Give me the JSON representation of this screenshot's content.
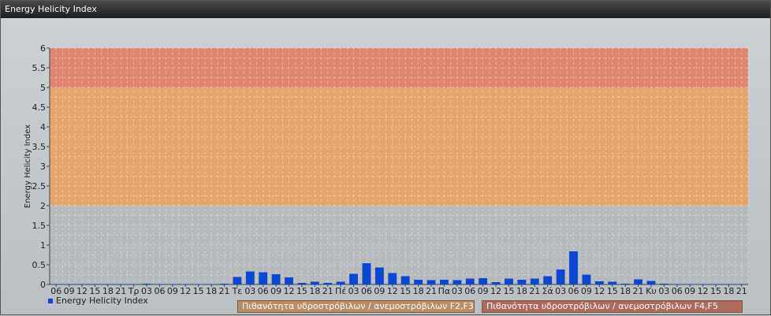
{
  "window": {
    "title": "Energy Helicity Index"
  },
  "chart_data": {
    "type": "bar",
    "title": "",
    "ylabel": "Energy Helicity Index",
    "xlabel": "",
    "ylim": [
      0,
      6
    ],
    "yticks": [
      "0",
      "0.5",
      "1",
      "1.5",
      "2",
      "2.5",
      "3",
      "3.5",
      "4",
      "4.5",
      "5",
      "5.5",
      "6"
    ],
    "categories": [
      "06",
      "09",
      "12",
      "15",
      "18",
      "21",
      "Τρ",
      "03",
      "06",
      "09",
      "12",
      "15",
      "18",
      "21",
      "Τε",
      "03",
      "06",
      "09",
      "12",
      "15",
      "18",
      "21",
      "Πέ",
      "03",
      "06",
      "09",
      "12",
      "15",
      "18",
      "21",
      "Πα",
      "03",
      "06",
      "09",
      "12",
      "15",
      "18",
      "21",
      "Σά",
      "03",
      "06",
      "09",
      "12",
      "15",
      "18",
      "21",
      "Κυ",
      "03",
      "06",
      "09",
      "12",
      "15",
      "18",
      "21"
    ],
    "series": [
      {
        "name": "Energy Helicity Index",
        "color": "#0b47d4",
        "values": [
          0.01,
          0.01,
          0.01,
          0.01,
          0.01,
          0.01,
          0.01,
          0.02,
          0.01,
          0.01,
          0.01,
          0.01,
          0.01,
          0.02,
          0.19,
          0.33,
          0.31,
          0.26,
          0.18,
          0.04,
          0.07,
          0.04,
          0.07,
          0.27,
          0.54,
          0.43,
          0.29,
          0.21,
          0.12,
          0.11,
          0.12,
          0.11,
          0.15,
          0.16,
          0.06,
          0.15,
          0.12,
          0.15,
          0.21,
          0.38,
          0.84,
          0.25,
          0.08,
          0.07,
          0.02,
          0.13,
          0.09,
          0.02,
          0.01,
          0.01,
          0.01,
          0.01,
          0.01,
          0.01
        ]
      }
    ],
    "bands": [
      {
        "from": 0,
        "to": 2,
        "color": "#b6babd"
      },
      {
        "from": 2,
        "to": 5,
        "color": "#e4a46c",
        "label": "Πιθανότητα υδροστρόβιλων / ανεμοστρόβιλων F2,F3"
      },
      {
        "from": 5,
        "to": 6,
        "color": "#e08670",
        "label": "Πιθανότητα υδροστρόβιλων / ανεμοστρόβιλων F4,F5"
      }
    ],
    "grid": true,
    "legend": "bottom-left"
  }
}
